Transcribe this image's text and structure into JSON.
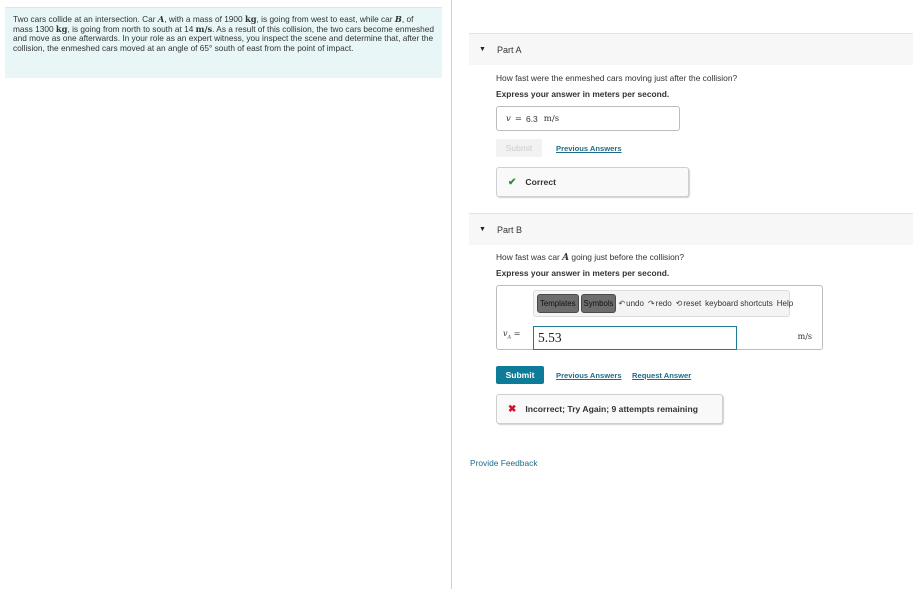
{
  "problem": {
    "segments": [
      {
        "t": "Two cars collide at an intersection. Car "
      },
      {
        "m": "A",
        "italic": true
      },
      {
        "t": ", with a mass of 1900 "
      },
      {
        "m": "kg"
      },
      {
        "t": ", is going from west to east, while car "
      },
      {
        "m": "B",
        "italic": true
      },
      {
        "t": ", of mass 1300 "
      },
      {
        "m": "kg"
      },
      {
        "t": ", is going from north to south at 14 "
      },
      {
        "m": "m/s"
      },
      {
        "t": ". As a result of this collision, the two cars become enmeshed and move as one afterwards. In your role as an expert witness, you inspect the scene and determine that, after the collision, the enmeshed cars moved at an angle of 65° south of east from the point of impact."
      }
    ]
  },
  "part_a": {
    "header": "Part A",
    "question": "How fast were the enmeshed cars moving just after the collision?",
    "instruction": "Express your answer in meters per second.",
    "answer_var": "v",
    "answer_eq": "=",
    "answer_value": "6.3",
    "answer_unit": "m/s",
    "submit_label": "Submit",
    "previous_answers_label": "Previous Answers",
    "feedback_icon": "check-icon",
    "feedback_text": "Correct"
  },
  "part_b": {
    "header": "Part B",
    "question_pre": "How fast was car ",
    "question_var": "A",
    "question_post": " going just before the collision?",
    "instruction": "Express your answer in meters per second.",
    "toolbar": {
      "templates_label": "Templates",
      "symbols_label": "Symbols",
      "undo_label": "undo",
      "redo_label": "redo",
      "reset_label": "reset",
      "keyboard_shortcuts_label": "keyboard shortcuts",
      "help_label": "Help"
    },
    "answer_var": "v",
    "answer_sub": "A",
    "answer_eq": "=",
    "input_value": "5.53",
    "answer_unit": "m/s",
    "submit_label": "Submit",
    "previous_answers_label": "Previous Answers",
    "request_answer_label": "Request Answer",
    "feedback_icon": "x-icon",
    "feedback_text": "Incorrect; Try Again; 9 attempts remaining"
  },
  "footer": {
    "provide_feedback_label": "Provide Feedback"
  },
  "colors": {
    "accent": "#0e7c99",
    "link": "#1f6b8a",
    "correct": "#2e8b3e",
    "incorrect": "#d0112b",
    "problem_bg": "#e8f6f8"
  }
}
